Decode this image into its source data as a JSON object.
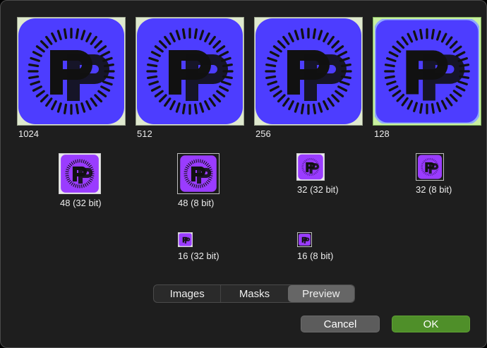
{
  "colors": {
    "icon_blue": "#4d3dff",
    "icon_purple": "#9a3cff",
    "ok_green": "#4f8f29",
    "selection_green": "#c8f0a0"
  },
  "icons": {
    "large": [
      {
        "size_label": "1024",
        "glyph": "pp-app-icon"
      },
      {
        "size_label": "512",
        "glyph": "pp-app-icon"
      },
      {
        "size_label": "256",
        "glyph": "pp-app-icon"
      },
      {
        "size_label": "128",
        "glyph": "pp-app-icon",
        "selected": true
      }
    ],
    "small": [
      {
        "label": "48 (32 bit)"
      },
      {
        "label": "48 (8 bit)"
      },
      {
        "label": "32 (32 bit)"
      },
      {
        "label": "32 (8 bit)"
      },
      {
        "label": "16 (32 bit)"
      },
      {
        "label": "16 (8 bit)"
      }
    ]
  },
  "view_tabs": {
    "items": [
      "Images",
      "Masks",
      "Preview"
    ],
    "selected": "Preview"
  },
  "buttons": {
    "cancel": "Cancel",
    "ok": "OK"
  }
}
